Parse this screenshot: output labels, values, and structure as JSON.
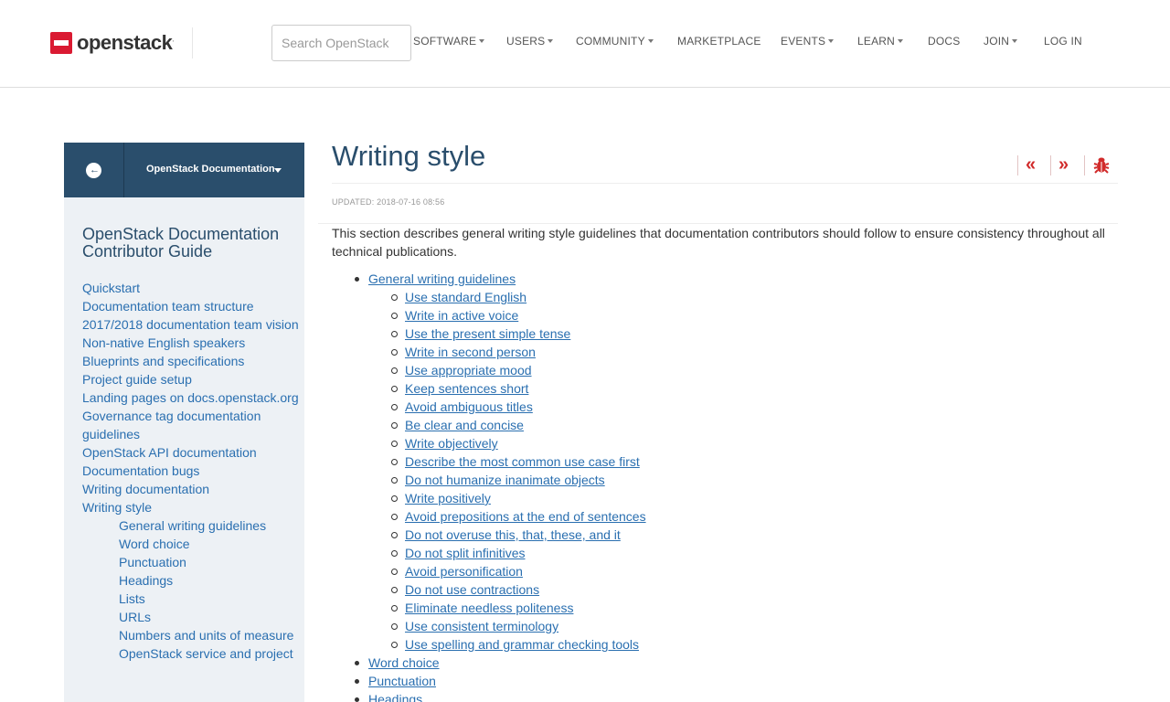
{
  "header": {
    "logo_text": "openstack",
    "logo_reg": ".",
    "search_placeholder": "Search OpenStack",
    "nav": [
      {
        "label": "SOFTWARE",
        "caret": true
      },
      {
        "label": "USERS",
        "caret": true
      },
      {
        "label": "COMMUNITY",
        "caret": true
      },
      {
        "label": "MARKETPLACE",
        "caret": false
      },
      {
        "label": "EVENTS",
        "caret": true
      },
      {
        "label": "LEARN",
        "caret": true
      },
      {
        "label": "DOCS",
        "caret": false
      },
      {
        "label": "JOIN",
        "caret": true
      },
      {
        "label": "LOG IN",
        "caret": false
      }
    ]
  },
  "sidebar": {
    "dropdown_label": "OpenStack Documentation",
    "back_icon": "circle-arrow-left-icon",
    "guide_title": "OpenStack Documentation Contributor Guide",
    "links": [
      "Quickstart",
      "Documentation team structure",
      "2017/2018 documentation team vision",
      "Non-native English speakers",
      "Blueprints and specifications",
      "Project guide setup",
      "Landing pages on docs.openstack.org",
      "Governance tag documentation guidelines",
      "OpenStack API documentation",
      "Documentation bugs",
      "Writing documentation",
      "Writing style"
    ],
    "sublinks": [
      "General writing guidelines",
      "Word choice",
      "Punctuation",
      "Headings",
      "Lists",
      "URLs",
      "Numbers and units of measure",
      "OpenStack service and project"
    ]
  },
  "main": {
    "title": "Writing style",
    "updated": "UPDATED: 2018-07-16 08:56",
    "intro": "This section describes general writing style guidelines that documentation contributors should follow to ensure consistency throughout all technical publications.",
    "tool_icons": [
      "double-chevron-left-icon",
      "double-chevron-right-icon",
      "bug-icon"
    ],
    "toc_top": "General writing guidelines",
    "toc_sub": [
      "Use standard English",
      "Write in active voice",
      "Use the present simple tense",
      "Write in second person",
      "Use appropriate mood",
      "Keep sentences short",
      "Avoid ambiguous titles",
      "Be clear and concise",
      "Write objectively",
      "Describe the most common use case first",
      "Do not humanize inanimate objects",
      "Write positively",
      "Avoid prepositions at the end of sentences",
      "Do not overuse this, that, these, and it",
      "Do not split infinitives",
      "Avoid personification",
      "Do not use contractions",
      "Eliminate needless politeness",
      "Use consistent terminology",
      "Use spelling and grammar checking tools"
    ],
    "toc_after": [
      "Word choice",
      "Punctuation",
      "Headings"
    ]
  },
  "colors": {
    "brand_red": "#da1a32",
    "sidebar_header": "#2a4e6c",
    "sidebar_bg": "#edf1f5",
    "link": "#2a6fb0",
    "tool_red": "#d12b2b"
  }
}
